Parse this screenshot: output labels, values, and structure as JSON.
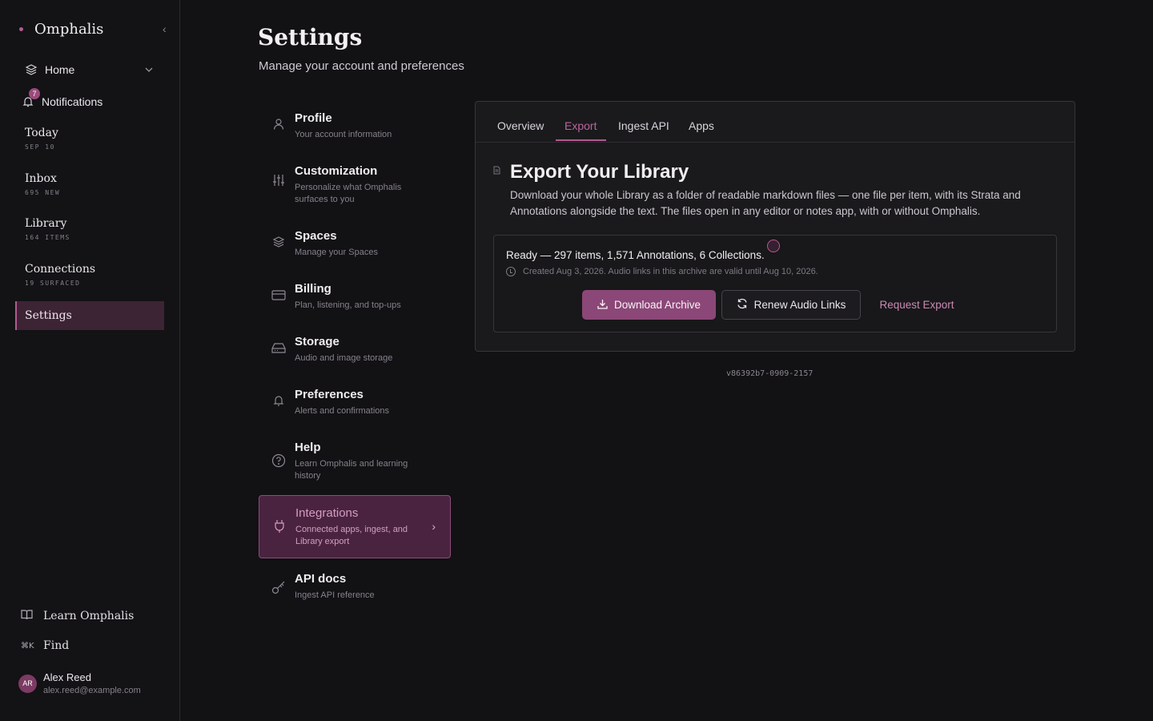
{
  "sidebar": {
    "brand": "Omphalis",
    "nav": {
      "home": "Home",
      "notifications": "Notifications",
      "notifications_badge": "7"
    },
    "sections": [
      {
        "title": "Today",
        "sub": "SEP 10"
      },
      {
        "title": "Inbox",
        "sub": "695 NEW"
      },
      {
        "title": "Library",
        "sub": "164 ITEMS"
      },
      {
        "title": "Connections",
        "sub": "19 SURFACED"
      }
    ],
    "active": "Settings",
    "footer": {
      "learn": "Learn Omphalis",
      "find_shortcut": "⌘K",
      "find": "Find"
    },
    "user": {
      "initials": "AR",
      "name": "Alex Reed",
      "email": "alex.reed@example.com"
    }
  },
  "header": {
    "title": "Settings",
    "subtitle": "Manage your account and preferences"
  },
  "settings_menu": [
    {
      "title": "Profile",
      "desc": "Your account information",
      "icon": "user-icon"
    },
    {
      "title": "Customization",
      "desc": "Personalize what Omphalis surfaces to you",
      "icon": "sliders-icon"
    },
    {
      "title": "Spaces",
      "desc": "Manage your Spaces",
      "icon": "layers-icon"
    },
    {
      "title": "Billing",
      "desc": "Plan, listening, and top-ups",
      "icon": "credit-card-icon"
    },
    {
      "title": "Storage",
      "desc": "Audio and image storage",
      "icon": "drive-icon"
    },
    {
      "title": "Preferences",
      "desc": "Alerts and confirmations",
      "icon": "bell-icon"
    },
    {
      "title": "Help",
      "desc": "Learn Omphalis and learning history",
      "icon": "help-circle-icon"
    },
    {
      "title": "Integrations",
      "desc": "Connected apps, ingest, and Library export",
      "icon": "plug-icon"
    },
    {
      "title": "API docs",
      "desc": "Ingest API reference",
      "icon": "key-icon"
    }
  ],
  "panel": {
    "tabs": [
      "Overview",
      "Export",
      "Ingest API",
      "Apps"
    ],
    "active_tab": "Export",
    "title": "Export Your Library",
    "description": "Download your whole Library as a folder of readable markdown files — one file per item, with its Strata and Annotations alongside the text. The files open in any editor or notes app, with or without Omphalis.",
    "status": "Ready — 297 items, 1,571 Annotations, 6 Collections.",
    "created": "Created Aug 3, 2026. Audio links in this archive are valid until Aug 10, 2026.",
    "buttons": {
      "download": "Download Archive",
      "renew": "Renew Audio Links",
      "request": "Request Export"
    }
  },
  "version": "v86392b7-0909-2157",
  "colors": {
    "accent": "#b35a90",
    "background": "#121114",
    "panel": "#1a191c"
  }
}
